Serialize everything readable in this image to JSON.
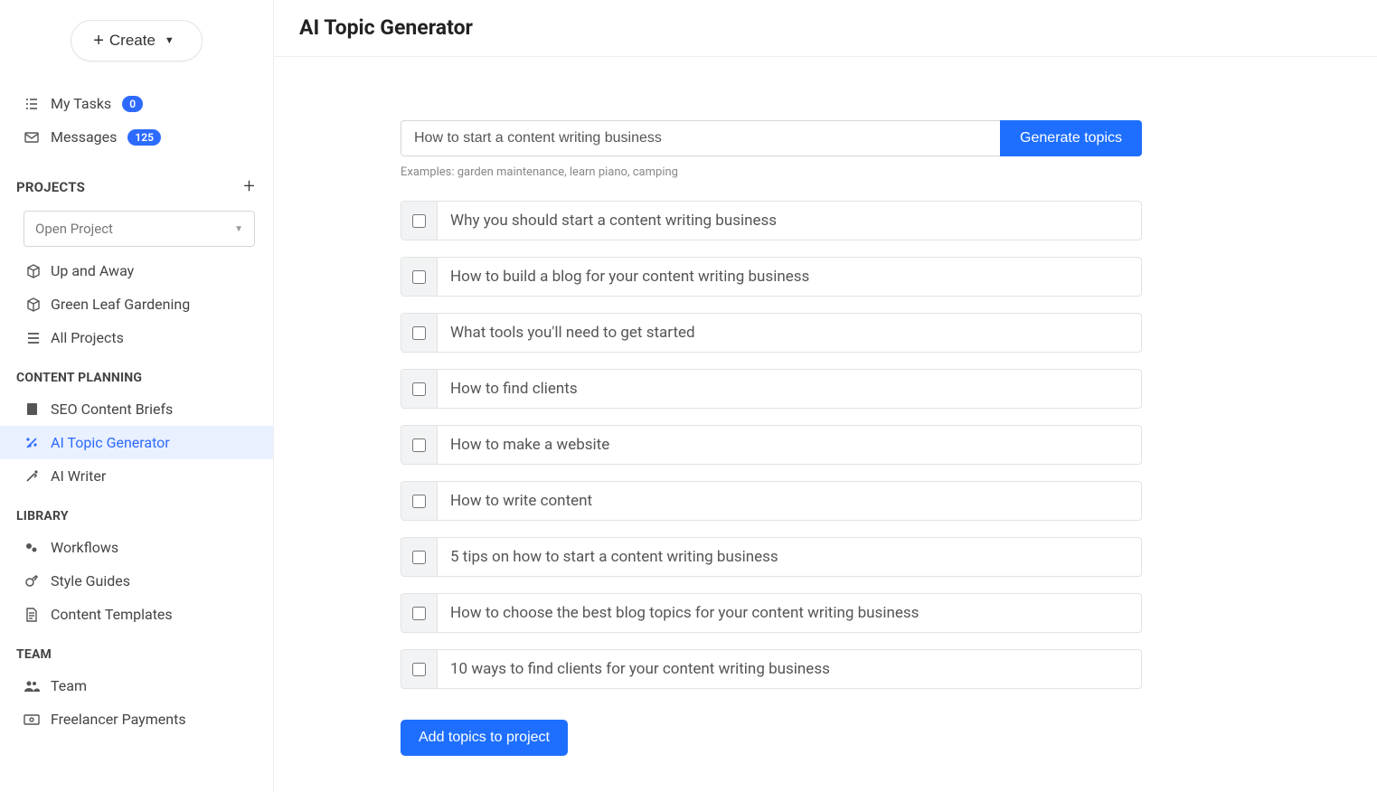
{
  "create_label": "Create",
  "nav_top": [
    {
      "label": "My Tasks",
      "badge": "0",
      "icon": "tasks"
    },
    {
      "label": "Messages",
      "badge": "125",
      "icon": "mail"
    }
  ],
  "projects_heading": "PROJECTS",
  "open_project_label": "Open Project",
  "projects": [
    {
      "label": "Up and Away",
      "icon": "cube"
    },
    {
      "label": "Green Leaf Gardening",
      "icon": "cube"
    },
    {
      "label": "All Projects",
      "icon": "list"
    }
  ],
  "content_planning_heading": "CONTENT PLANNING",
  "content_planning": [
    {
      "label": "SEO Content Briefs",
      "icon": "note",
      "active": false
    },
    {
      "label": "AI Topic Generator",
      "icon": "wand",
      "active": true
    },
    {
      "label": "AI Writer",
      "icon": "wand2",
      "active": false
    }
  ],
  "library_heading": "LIBRARY",
  "library": [
    {
      "label": "Workflows",
      "icon": "gears"
    },
    {
      "label": "Style Guides",
      "icon": "palette"
    },
    {
      "label": "Content Templates",
      "icon": "file"
    }
  ],
  "team_heading": "TEAM",
  "team": [
    {
      "label": "Team",
      "icon": "people"
    },
    {
      "label": "Freelancer Payments",
      "icon": "cash"
    }
  ],
  "page_title": "AI Topic Generator",
  "input_value": "How to start a content writing business",
  "generate_label": "Generate topics",
  "examples_text": "Examples: garden maintenance, learn piano, camping",
  "topics": [
    "Why you should start a content writing business",
    "How to build a blog for your content writing business",
    "What tools you'll need to get started",
    "How to find clients",
    "How to make a website",
    "How to write content",
    "5 tips on how to start a content writing business",
    "How to choose the best blog topics for your content writing business",
    "10 ways to find clients for your content writing business"
  ],
  "add_topics_label": "Add topics to project"
}
